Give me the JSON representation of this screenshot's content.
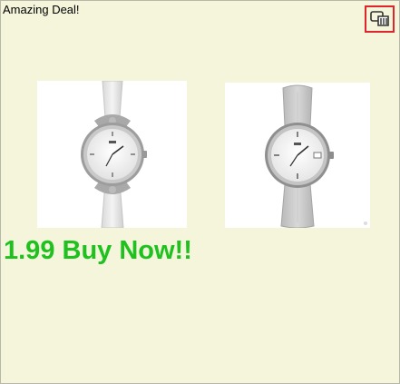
{
  "ad": {
    "title": "Amazing Deal!",
    "cta": "1.99 Buy Now!!",
    "cta_color": "#1fc11f"
  },
  "controls": {
    "corner_icon": "ad-choices-icon"
  },
  "products": [
    {
      "image": "slim-leather-watch-icon"
    },
    {
      "image": "leather-watch-icon"
    }
  ]
}
